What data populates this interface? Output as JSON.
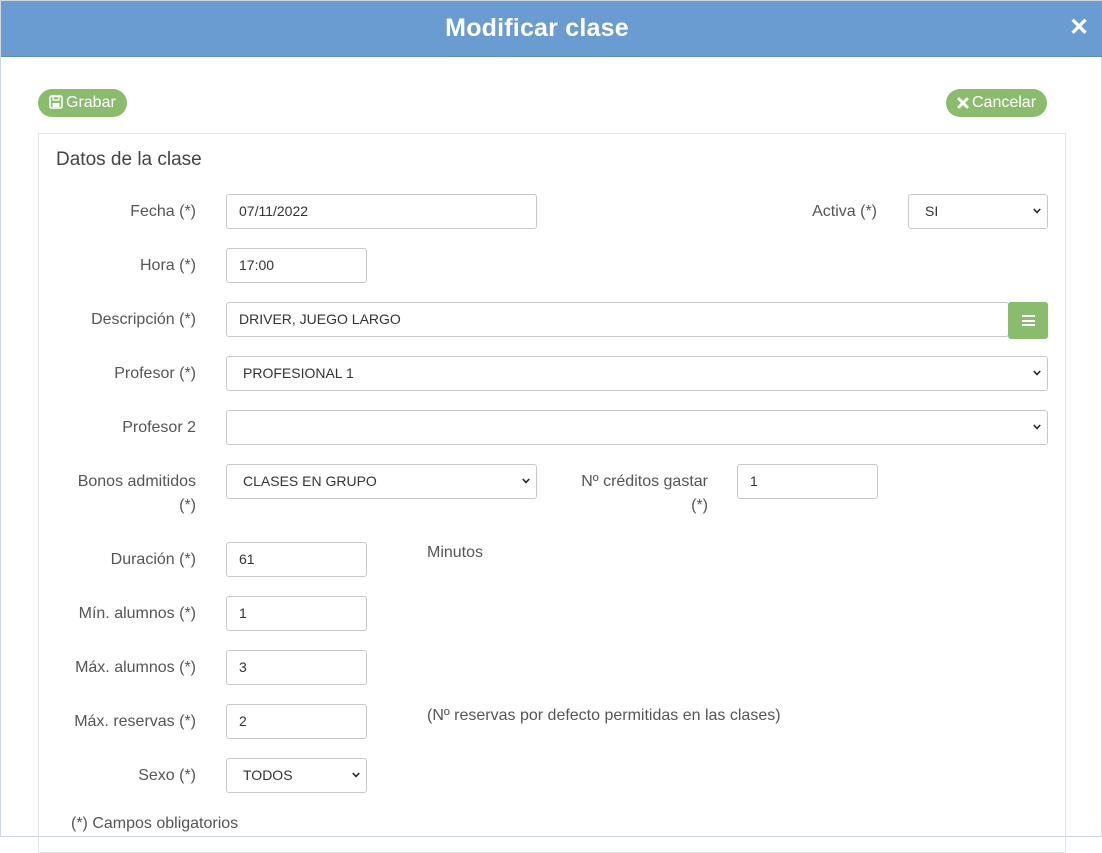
{
  "header": {
    "title": "Modificar clase",
    "close_icon": "close-icon"
  },
  "toolbar": {
    "save_label": "Grabar",
    "cancel_label": "Cancelar"
  },
  "section_title": "Datos de la clase",
  "form": {
    "fecha": {
      "label": "Fecha (*)",
      "value": "07/11/2022"
    },
    "activa": {
      "label": "Activa (*)",
      "value": "SI"
    },
    "hora": {
      "label": "Hora (*)",
      "value": "17:00"
    },
    "descripcion": {
      "label": "Descripción (*)",
      "value": "DRIVER, JUEGO LARGO",
      "list_icon": "list-icon"
    },
    "profesor": {
      "label": "Profesor (*)",
      "value": "PROFESIONAL 1"
    },
    "profesor2": {
      "label": "Profesor 2",
      "value": ""
    },
    "bonos": {
      "label_line1": "Bonos admitidos",
      "label_line2": "(*)",
      "value": "CLASES EN GRUPO"
    },
    "creditos": {
      "label_line1": "Nº créditos gastar",
      "label_line2": "(*)",
      "value": "1"
    },
    "duracion": {
      "label": "Duración (*)",
      "value": "61",
      "unit": "Minutos"
    },
    "min_alumnos": {
      "label": "Mín. alumnos (*)",
      "value": "1"
    },
    "max_alumnos": {
      "label": "Máx. alumnos (*)",
      "value": "3"
    },
    "max_reservas": {
      "label": "Máx. reservas (*)",
      "value": "2",
      "note": "(Nº reservas por defecto permitidas en las clases)"
    },
    "sexo": {
      "label": "Sexo (*)",
      "value": "TODOS"
    }
  },
  "footer_note": "(*) Campos obligatorios",
  "colors": {
    "header": "#6a9bd1",
    "button": "#8bbb6d"
  }
}
